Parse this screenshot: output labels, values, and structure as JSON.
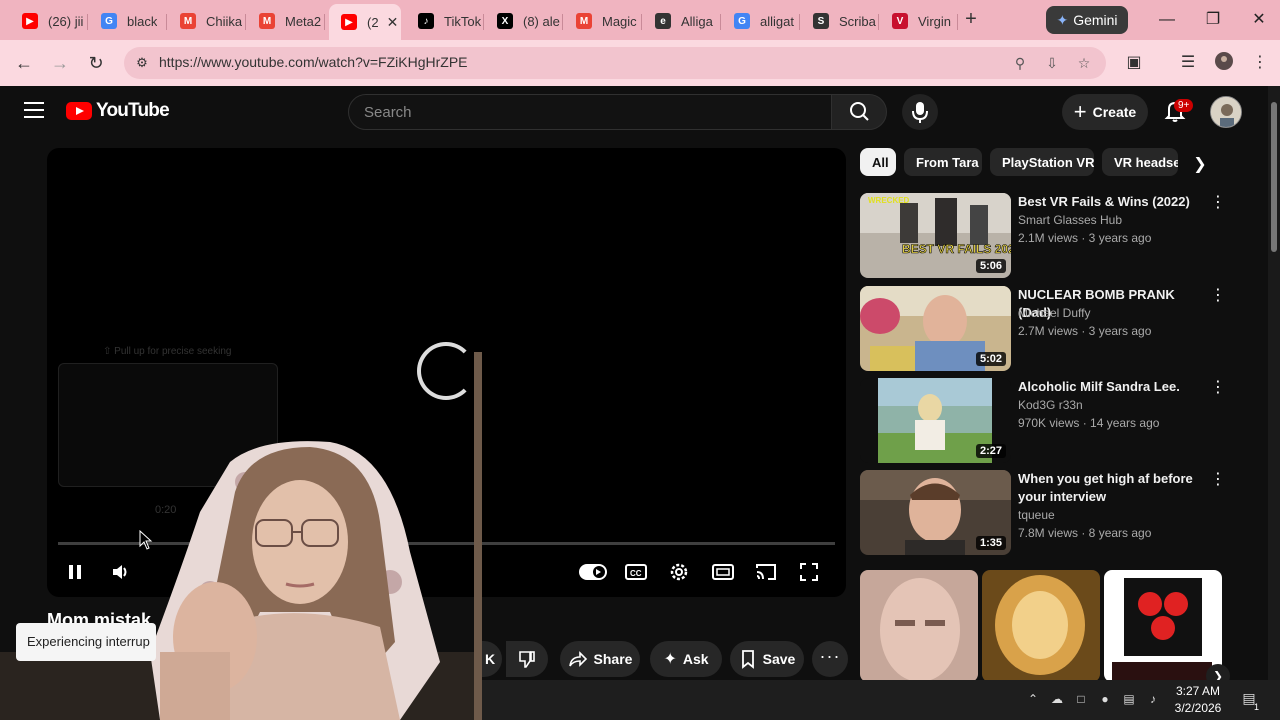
{
  "browser": {
    "tabs": [
      {
        "label": "(26) jii",
        "icon": "youtube-icon",
        "color": "#ff0000"
      },
      {
        "label": "black",
        "icon": "google-icon",
        "color": "#4285f4"
      },
      {
        "label": "Chiika",
        "icon": "gmail-icon",
        "color": "#ea4335"
      },
      {
        "label": "Meta2",
        "icon": "gmail-icon",
        "color": "#ea4335"
      },
      {
        "label": "(2",
        "icon": "youtube-icon",
        "color": "#ff0000",
        "active": true
      },
      {
        "label": "TikTok",
        "icon": "tiktok-icon",
        "color": "#000000"
      },
      {
        "label": "(8) ale",
        "icon": "x-icon",
        "color": "#000000"
      },
      {
        "label": "Magic",
        "icon": "gmail-icon",
        "color": "#ea4335"
      },
      {
        "label": "Alliga",
        "icon": "edge-e-icon",
        "color": "#333333"
      },
      {
        "label": "alligat",
        "icon": "google-icon",
        "color": "#4285f4"
      },
      {
        "label": "Scriba",
        "icon": "scribd-icon",
        "color": "#333333"
      },
      {
        "label": "Virgin",
        "icon": "virgin-icon",
        "color": "#c8102e"
      }
    ],
    "new_tab": "+",
    "gemini_label": "Gemini",
    "url": "https://www.youtube.com/watch?v=FZiKHgHrZPE"
  },
  "youtube": {
    "logo_text": "YouTube",
    "search_placeholder": "Search",
    "create_label": "Create",
    "notification_badge": "9+",
    "player": {
      "seek_hint": "⇧ Pull up for precise seeking",
      "preview_time": "0:20"
    },
    "video_title": "Mom mistak",
    "toast": "Experiencing interrup",
    "actions": {
      "like_count_fragment": "K",
      "share": "Share",
      "ask": "Ask",
      "save": "Save"
    },
    "chips": [
      "All",
      "From Tara",
      "PlayStation VR",
      "VR headse"
    ],
    "recommendations": [
      {
        "title": "Best VR Fails & Wins (2022)",
        "channel": "Smart Glasses Hub",
        "meta": "2.1M views · 3 years ago",
        "duration": "5:06",
        "thumb_text": "BEST VR FAILS 2022",
        "thumb_badge": "WRECKED"
      },
      {
        "title": "NUCLEAR BOMB PRANK (Dad)",
        "channel": "Michael Duffy",
        "meta": "2.7M views · 3 years ago",
        "duration": "5:02"
      },
      {
        "title": "Alcoholic Milf Sandra Lee.",
        "channel": "Kod3G r33n",
        "meta": "970K views · 14 years ago",
        "duration": "2:27"
      },
      {
        "title": "When you get high af before your interview",
        "channel": "tqueue",
        "meta": "7.8M views · 8 years ago",
        "duration": "1:35"
      }
    ]
  },
  "taskbar": {
    "time": "3:27 AM",
    "date": "3/2/2026",
    "notif_count": "1"
  }
}
